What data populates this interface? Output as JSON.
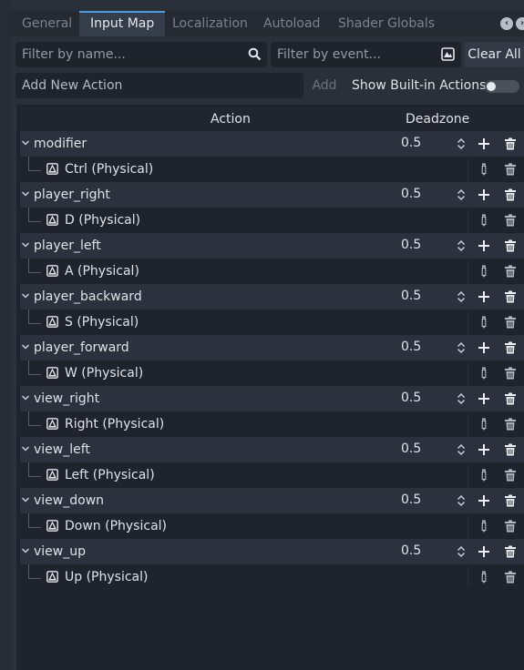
{
  "tabs": [
    {
      "label": "General",
      "active": false
    },
    {
      "label": "Input Map",
      "active": true
    },
    {
      "label": "Localization",
      "active": false
    },
    {
      "label": "Autoload",
      "active": false
    },
    {
      "label": "Shader Globals",
      "active": false
    }
  ],
  "filter": {
    "name_placeholder": "Filter by name...",
    "event_placeholder": "Filter by event...",
    "clear_all": "Clear All"
  },
  "add_action": {
    "placeholder": "Add New Action",
    "add_label": "Add",
    "show_builtin_label": "Show Built-in Actions",
    "show_builtin_on": false
  },
  "tree": {
    "header_action": "Action",
    "header_deadzone": "Deadzone",
    "actions": [
      {
        "name": "modifier",
        "deadzone": "0.5",
        "event": "Ctrl (Physical)"
      },
      {
        "name": "player_right",
        "deadzone": "0.5",
        "event": "D (Physical)"
      },
      {
        "name": "player_left",
        "deadzone": "0.5",
        "event": "A (Physical)"
      },
      {
        "name": "player_backward",
        "deadzone": "0.5",
        "event": "S (Physical)"
      },
      {
        "name": "player_forward",
        "deadzone": "0.5",
        "event": "W (Physical)"
      },
      {
        "name": "view_right",
        "deadzone": "0.5",
        "event": "Right (Physical)"
      },
      {
        "name": "view_left",
        "deadzone": "0.5",
        "event": "Left (Physical)"
      },
      {
        "name": "view_down",
        "deadzone": "0.5",
        "event": "Down (Physical)"
      },
      {
        "name": "view_up",
        "deadzone": "0.5",
        "event": "Up (Physical)"
      }
    ]
  },
  "colors": {
    "accent": "#4d9ee8",
    "background": "#21262e",
    "panel": "#2a303a",
    "action_row": "#2c323d"
  }
}
